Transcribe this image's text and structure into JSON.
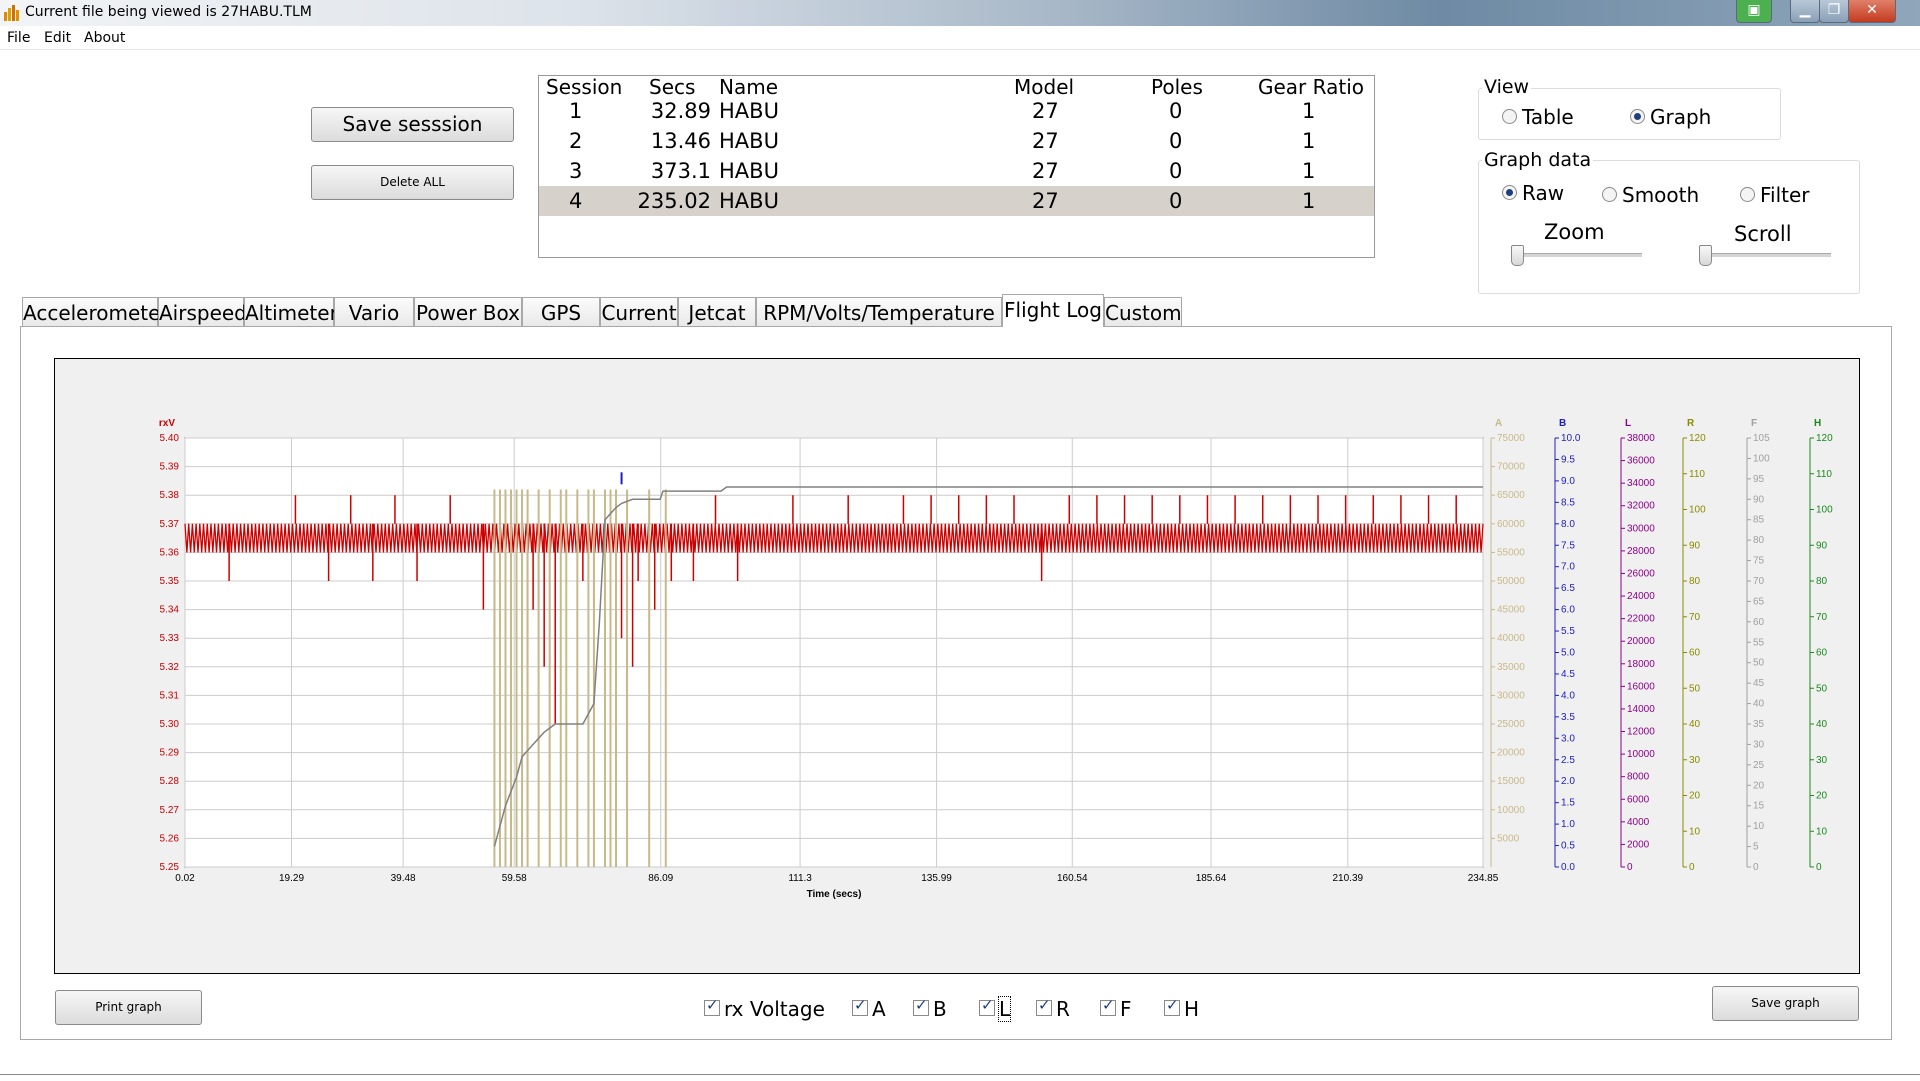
{
  "window": {
    "title": "Current file being viewed is 27HABU.TLM"
  },
  "menu": [
    "File",
    "Edit",
    "About"
  ],
  "buttons": {
    "save_session": "Save sesssion",
    "delete_all": "Delete ALL",
    "print_graph": "Print graph",
    "save_graph": "Save graph"
  },
  "sessions": {
    "columns": [
      "Session",
      "Secs",
      "Name",
      "Model",
      "Poles",
      "Gear Ratio"
    ],
    "rows": [
      [
        "1",
        "32.89",
        "HABU",
        "27",
        "0",
        "1"
      ],
      [
        "2",
        "13.46",
        "HABU",
        "27",
        "0",
        "1"
      ],
      [
        "3",
        "373.1",
        "HABU",
        "27",
        "0",
        "1"
      ],
      [
        "4",
        "235.02",
        "HABU",
        "27",
        "0",
        "1"
      ]
    ],
    "selected_row": 3
  },
  "view": {
    "title": "View",
    "options": [
      "Table",
      "Graph"
    ],
    "selected": "Graph"
  },
  "graph_data": {
    "title": "Graph data",
    "options": [
      "Raw",
      "Smooth",
      "Filter"
    ],
    "selected": "Raw",
    "zoom_label": "Zoom",
    "scroll_label": "Scroll",
    "zoom_value": 0,
    "scroll_value": 0
  },
  "tabs": [
    "Accelerometer",
    "Airspeed",
    "Altimeter",
    "Vario",
    "Power Box",
    "GPS",
    "Current",
    "Jetcat",
    "RPM/Volts/Temperature",
    "Flight Log",
    "Custom"
  ],
  "active_tab": "Flight Log",
  "series_checkboxes": [
    {
      "label": "rx Voltage",
      "checked": true
    },
    {
      "label": "A",
      "checked": true
    },
    {
      "label": "B",
      "checked": true
    },
    {
      "label": "L",
      "checked": true
    },
    {
      "label": "R",
      "checked": true
    },
    {
      "label": "F",
      "checked": true
    },
    {
      "label": "H",
      "checked": true
    }
  ],
  "colors": {
    "rxv": "#cc0000",
    "A": "#c8b98a",
    "B": "#2020c0",
    "L": "#8b008b",
    "R": "#8b8b00",
    "F": "#a0a0a0",
    "H": "#1a8a1a",
    "grid": "#cccccc"
  },
  "chart_data": {
    "type": "line",
    "xlabel": "Time (secs)",
    "xlim": [
      0.02,
      234.85
    ],
    "x_ticks": [
      "0.02",
      "19.29",
      "39.48",
      "59.58",
      "86.09",
      "111.3",
      "135.99",
      "160.54",
      "185.64",
      "210.39",
      "234.85"
    ],
    "axes": [
      {
        "name": "rxV",
        "side": "left",
        "range": [
          5.25,
          5.4
        ],
        "ticks": [
          "5.40",
          "5.39",
          "5.38",
          "5.37",
          "5.36",
          "5.35",
          "5.34",
          "5.33",
          "5.32",
          "5.31",
          "5.30",
          "5.29",
          "5.28",
          "5.27",
          "5.26",
          "5.25"
        ]
      },
      {
        "name": "A",
        "side": "right",
        "range": [
          0,
          75000
        ],
        "ticks": [
          "75000",
          "70000",
          "65000",
          "60000",
          "55000",
          "50000",
          "45000",
          "40000",
          "35000",
          "30000",
          "25000",
          "20000",
          "15000",
          "10000",
          "5000"
        ]
      },
      {
        "name": "B",
        "side": "right",
        "range": [
          0,
          10
        ],
        "ticks": [
          "10.0",
          "9.5",
          "9.0",
          "8.5",
          "8.0",
          "7.5",
          "7.0",
          "6.5",
          "6.0",
          "5.5",
          "5.0",
          "4.5",
          "4.0",
          "3.5",
          "3.0",
          "2.5",
          "2.0",
          "1.5",
          "1.0",
          "0.5",
          "0.0"
        ]
      },
      {
        "name": "L",
        "side": "right",
        "range": [
          0,
          38000
        ],
        "ticks": [
          "38000",
          "36000",
          "34000",
          "32000",
          "30000",
          "28000",
          "26000",
          "24000",
          "22000",
          "20000",
          "18000",
          "16000",
          "14000",
          "12000",
          "10000",
          "8000",
          "6000",
          "4000",
          "2000",
          "0"
        ]
      },
      {
        "name": "R",
        "side": "right",
        "range": [
          0,
          120
        ],
        "ticks": [
          "120",
          "110",
          "100",
          "90",
          "80",
          "70",
          "60",
          "50",
          "40",
          "30",
          "20",
          "10",
          "0"
        ]
      },
      {
        "name": "F",
        "side": "right",
        "range": [
          0,
          105
        ],
        "ticks": [
          "105",
          "100",
          "95",
          "90",
          "85",
          "80",
          "75",
          "70",
          "65",
          "60",
          "55",
          "50",
          "45",
          "40",
          "35",
          "30",
          "25",
          "20",
          "15",
          "10",
          "5",
          "0"
        ]
      },
      {
        "name": "H",
        "side": "right",
        "range": [
          0,
          120
        ],
        "ticks": [
          "120",
          "110",
          "100",
          "90",
          "80",
          "70",
          "60",
          "50",
          "40",
          "30",
          "20",
          "10",
          "0"
        ]
      }
    ],
    "series": [
      {
        "name": "rxV",
        "axis": "rxV",
        "baseline": [
          5.36,
          5.37
        ],
        "spikes": [
          [
            8,
            5.35
          ],
          [
            20,
            5.38
          ],
          [
            26,
            5.35
          ],
          [
            30,
            5.38
          ],
          [
            34,
            5.35
          ],
          [
            38,
            5.38
          ],
          [
            42,
            5.35
          ],
          [
            48,
            5.38
          ],
          [
            54,
            5.34
          ],
          [
            56,
            5.33
          ],
          [
            58,
            5.3
          ],
          [
            59,
            5.27
          ],
          [
            60,
            5.33
          ],
          [
            61,
            5.31
          ],
          [
            62,
            5.26
          ],
          [
            63,
            5.34
          ],
          [
            64,
            5.29
          ],
          [
            65,
            5.32
          ],
          [
            66,
            5.27
          ],
          [
            67,
            5.3
          ],
          [
            68,
            5.34
          ],
          [
            72,
            5.35
          ],
          [
            74,
            5.34
          ],
          [
            76,
            5.33
          ],
          [
            77,
            5.35
          ],
          [
            78,
            5.26
          ],
          [
            79,
            5.33
          ],
          [
            80,
            5.27
          ],
          [
            81,
            5.32
          ],
          [
            82,
            5.35
          ],
          [
            85,
            5.34
          ],
          [
            88,
            5.35
          ],
          [
            92,
            5.35
          ],
          [
            96,
            5.38
          ],
          [
            100,
            5.35
          ],
          [
            110,
            5.38
          ],
          [
            120,
            5.38
          ],
          [
            130,
            5.38
          ],
          [
            135,
            5.38
          ],
          [
            140,
            5.38
          ],
          [
            145,
            5.38
          ],
          [
            150,
            5.38
          ],
          [
            155,
            5.35
          ],
          [
            160,
            5.38
          ],
          [
            165,
            5.38
          ],
          [
            170,
            5.38
          ],
          [
            175,
            5.38
          ],
          [
            180,
            5.38
          ],
          [
            185,
            5.38
          ],
          [
            190,
            5.38
          ],
          [
            195,
            5.38
          ],
          [
            200,
            5.38
          ],
          [
            205,
            5.38
          ],
          [
            210,
            5.38
          ],
          [
            215,
            5.38
          ],
          [
            220,
            5.38
          ],
          [
            225,
            5.38
          ],
          [
            230,
            5.38
          ]
        ]
      },
      {
        "name": "A",
        "axis": "A",
        "spikes": [
          56,
          57,
          58,
          59,
          60,
          61,
          62,
          64,
          66,
          68,
          69,
          71,
          73,
          74,
          76,
          77,
          78,
          80,
          84,
          87
        ]
      },
      {
        "name": "F",
        "axis": "F",
        "points": [
          [
            56,
            5
          ],
          [
            58,
            15
          ],
          [
            60,
            22
          ],
          [
            61,
            27
          ],
          [
            63,
            30
          ],
          [
            65,
            33
          ],
          [
            67,
            35
          ],
          [
            72,
            35
          ],
          [
            74,
            40
          ],
          [
            75,
            60
          ],
          [
            76,
            85
          ],
          [
            78,
            88
          ],
          [
            79,
            89
          ],
          [
            81,
            90
          ],
          [
            86,
            90
          ],
          [
            86.5,
            92
          ],
          [
            97,
            92
          ],
          [
            98,
            93
          ],
          [
            234.85,
            93
          ]
        ]
      },
      {
        "name": "B",
        "axis": "B",
        "spikes": [
          [
            79,
            9.2
          ]
        ]
      }
    ]
  }
}
